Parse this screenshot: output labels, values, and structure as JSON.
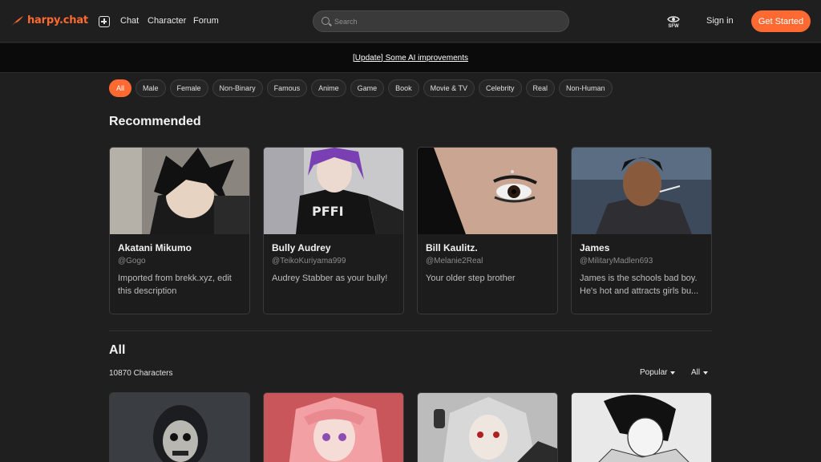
{
  "brand": {
    "name": "harpy.chat",
    "accent": "#ff6a33"
  },
  "nav": {
    "chat": "Chat",
    "character": "Character",
    "forum": "Forum"
  },
  "search": {
    "placeholder": "Search"
  },
  "header": {
    "sfw_label": "SFW",
    "sign_in": "Sign in",
    "get_started": "Get Started"
  },
  "announcement": {
    "text": "[Update] Some AI improvements"
  },
  "filters": [
    "All",
    "Male",
    "Female",
    "Non-Binary",
    "Famous",
    "Anime",
    "Game",
    "Book",
    "Movie & TV",
    "Celebrity",
    "Real",
    "Non-Human"
  ],
  "active_filter": "All",
  "recommended": {
    "title": "Recommended",
    "cards": [
      {
        "name": "Akatani Mikumo",
        "handle": "@Gogo",
        "description": "Imported from brekk.xyz, edit this description"
      },
      {
        "name": "Bully Audrey",
        "handle": "@TeikoKuriyama999",
        "description": "Audrey Stabber as your bully!"
      },
      {
        "name": "Bill Kaulitz.",
        "handle": "@Melanie2Real",
        "description": "Your older step brother"
      },
      {
        "name": "James",
        "handle": "@MilitaryMadlen693",
        "description": "James is the schools bad boy. He's hot and attracts girls bu..."
      }
    ]
  },
  "all_section": {
    "title": "All",
    "count_label": "10870 Characters",
    "sort": "Popular",
    "filter": "All"
  }
}
